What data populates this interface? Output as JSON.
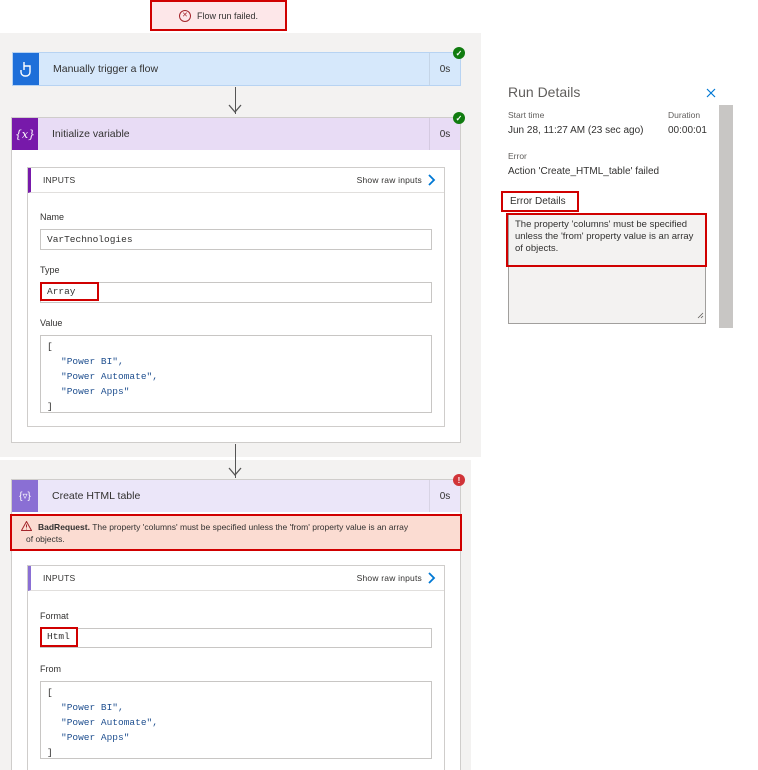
{
  "banner": {
    "text": "Flow run failed."
  },
  "trigger": {
    "title": "Manually trigger a flow",
    "duration": "0s"
  },
  "init_var": {
    "title": "Initialize variable",
    "duration": "0s",
    "inputs_label": "INPUTS",
    "show_raw": "Show raw inputs",
    "name_label": "Name",
    "name_value": "VarTechnologies",
    "type_label": "Type",
    "type_value": "Array",
    "value_label": "Value",
    "value_lines": [
      "[",
      "\"Power BI\",",
      "\"Power Automate\",",
      "\"Power Apps\"",
      "]"
    ]
  },
  "html_table": {
    "title": "Create HTML table",
    "duration": "0s",
    "error_code": "BadRequest.",
    "error_msg": "The property 'columns' must be specified unless the 'from' property value is an array",
    "error_msg2": "of objects.",
    "inputs_label": "INPUTS",
    "show_raw": "Show raw inputs",
    "format_label": "Format",
    "format_value": "Html",
    "from_label": "From",
    "from_lines": [
      "[",
      "\"Power BI\",",
      "\"Power Automate\",",
      "\"Power Apps\"",
      "]"
    ]
  },
  "run_details": {
    "title": "Run Details",
    "start_label": "Start time",
    "start_value": "Jun 28, 11:27 AM (23 sec ago)",
    "duration_label": "Duration",
    "duration_value": "00:00:01",
    "error_label": "Error",
    "error_value": "Action 'Create_HTML_table' failed",
    "error_details_label": "Error Details",
    "error_details_text": "The property 'columns' must be specified unless the 'from' property value is an array of objects."
  },
  "colors": {
    "trigger_accent": "#1e6fd9",
    "trigger_bg": "#d6e8fb",
    "variable_accent": "#7719aa",
    "variable_bg": "#e8dcf5",
    "table_accent": "#8a6fd4",
    "table_bg": "#ebe6f9",
    "success": "#107c10",
    "error": "#d13438",
    "highlight": "#d00000"
  }
}
